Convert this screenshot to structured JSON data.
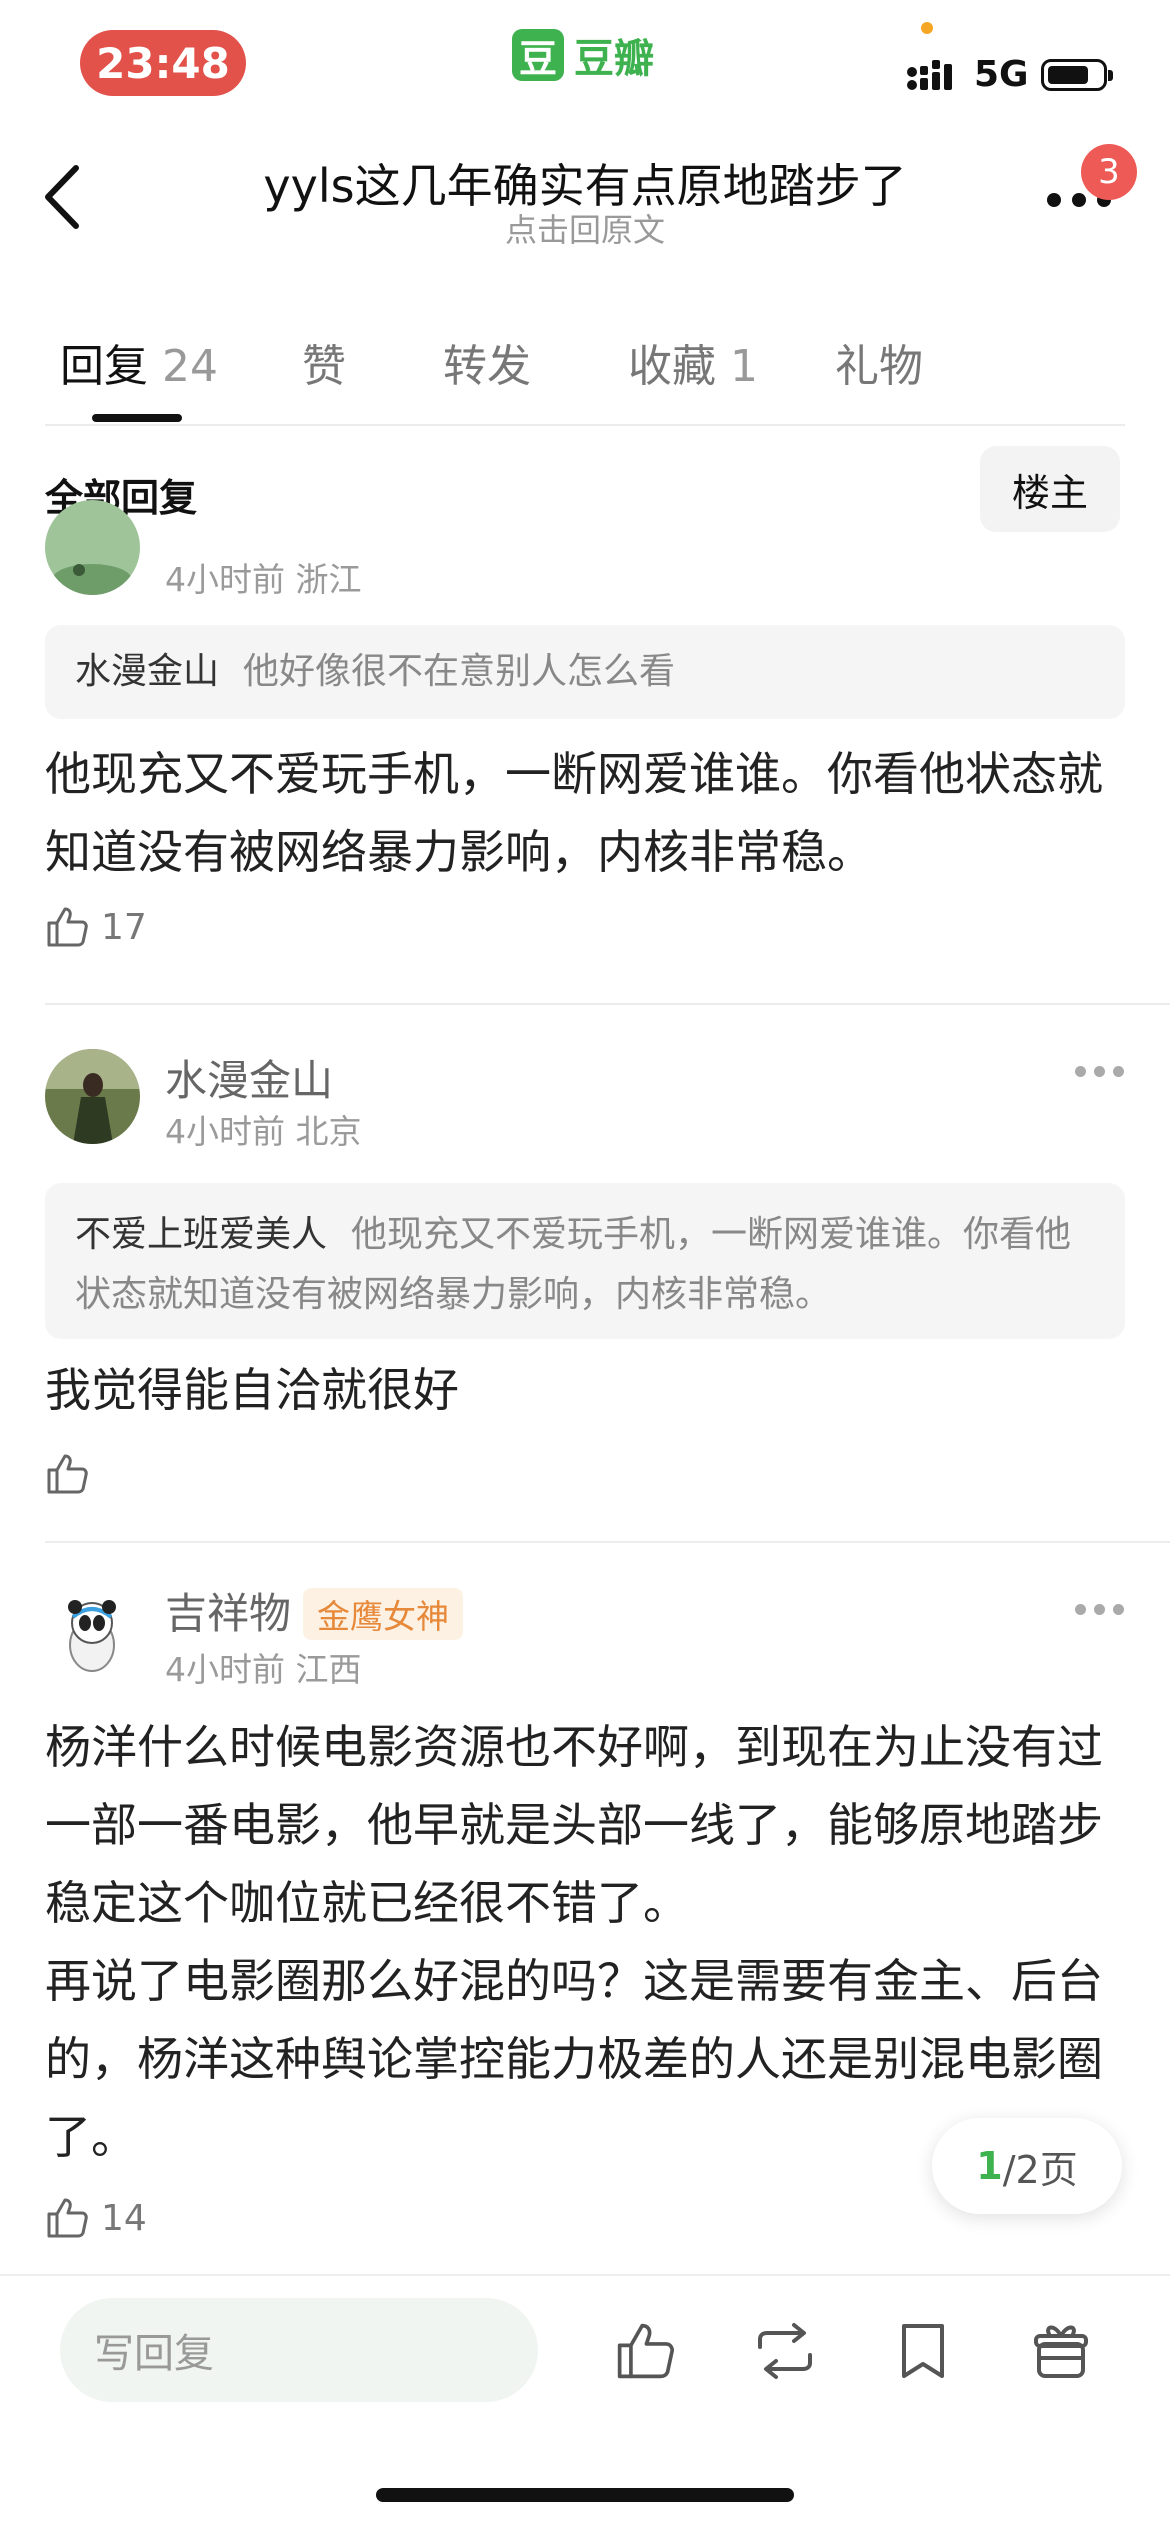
{
  "status_bar": {
    "time": "23:48",
    "network": "5G",
    "app_logo_char": "豆",
    "app_name": "豆瓣"
  },
  "header": {
    "title": "yyls这几年确实有点原地踏步了",
    "subtitle": "点击回原文",
    "notification_count": "3"
  },
  "tabs": [
    {
      "label": "回复",
      "count": "24"
    },
    {
      "label": "赞",
      "count": ""
    },
    {
      "label": "转发",
      "count": ""
    },
    {
      "label": "收藏",
      "count": "1"
    },
    {
      "label": "礼物",
      "count": ""
    }
  ],
  "section": {
    "title": "全部回复",
    "filter_button": "楼主"
  },
  "comments": [
    {
      "meta": "4小时前 浙江",
      "quote_name": "水漫金山",
      "quote_text": "他好像很不在意别人怎么看",
      "content": "他现充又不爱玩手机，一断网爱谁谁。你看他状态就知道没有被网络暴力影响，内核非常稳。",
      "likes": "17"
    },
    {
      "username": "水漫金山",
      "meta": "4小时前 北京",
      "quote_name": "不爱上班爱美人",
      "quote_text": "他现充又不爱玩手机，一断网爱谁谁。你看他状态就知道没有被网络暴力影响，内核非常稳。",
      "content": "我觉得能自洽就很好",
      "likes": ""
    },
    {
      "username": "吉祥物",
      "tag": "金鹰女神",
      "meta": "4小时前 江西",
      "content_1": "杨洋什么时候电影资源也不好啊，到现在为止没有过一部一番电影，他早就是头部一线了，能够原地踏步稳定这个咖位就已经很不错了。",
      "content_2": "再说了电影圈那么好混的吗？这是需要有金主、后台的，杨洋这种舆论掌控能力极差的人还是别混电影圈了。",
      "likes": "14"
    }
  ],
  "pagination": {
    "current": "1",
    "total": "/2页"
  },
  "bottom_bar": {
    "reply_placeholder": "写回复"
  },
  "colors": {
    "brand_green": "#3fb250",
    "time_pill": "#e2514a",
    "badge": "#ee5a56",
    "tag_text": "#e7893a"
  }
}
